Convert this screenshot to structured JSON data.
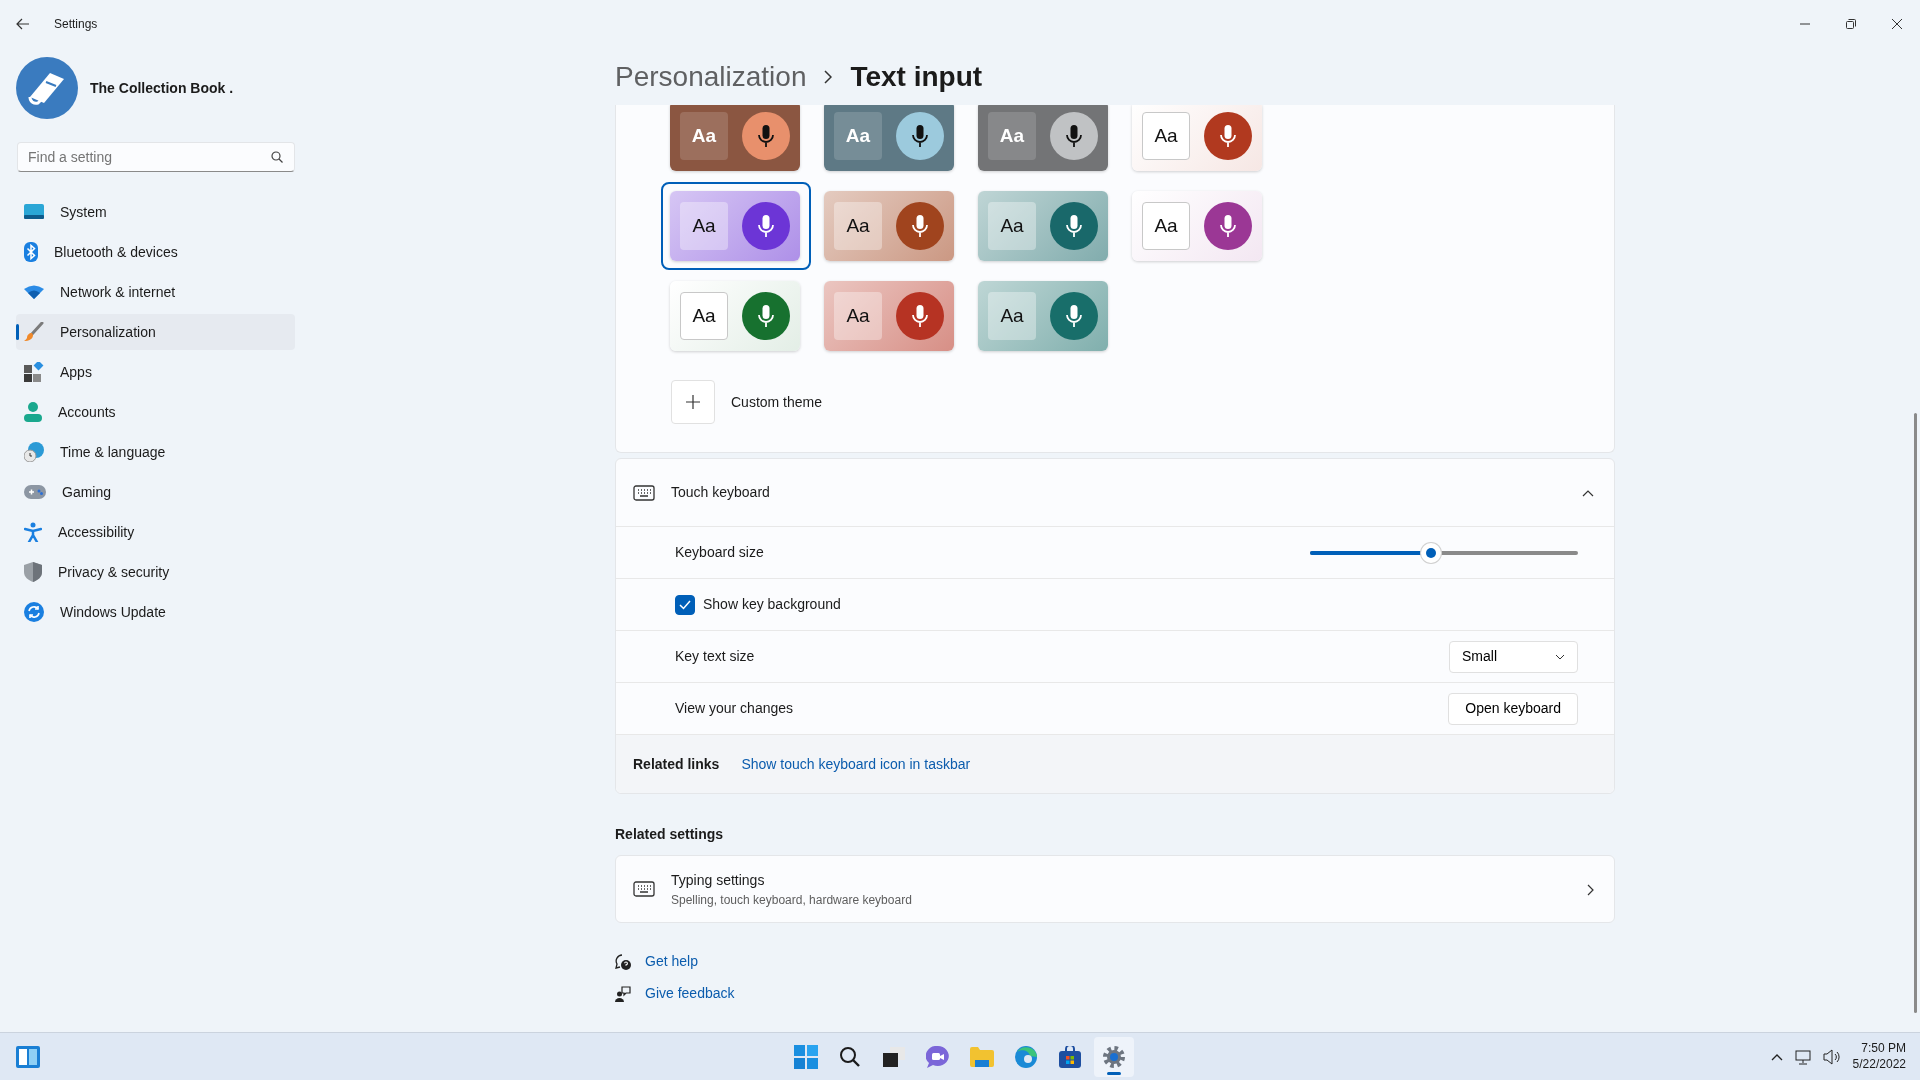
{
  "window": {
    "title": "Settings"
  },
  "profile": {
    "name": "The Collection Book ."
  },
  "search": {
    "placeholder": "Find a setting"
  },
  "nav": [
    {
      "kind": "system",
      "label": "System",
      "selected": false
    },
    {
      "kind": "bluetooth",
      "label": "Bluetooth & devices",
      "selected": false
    },
    {
      "kind": "network",
      "label": "Network & internet",
      "selected": false
    },
    {
      "kind": "personalization",
      "label": "Personalization",
      "selected": true
    },
    {
      "kind": "apps",
      "label": "Apps",
      "selected": false
    },
    {
      "kind": "accounts",
      "label": "Accounts",
      "selected": false
    },
    {
      "kind": "time",
      "label": "Time & language",
      "selected": false
    },
    {
      "kind": "gaming",
      "label": "Gaming",
      "selected": false
    },
    {
      "kind": "accessibility",
      "label": "Accessibility",
      "selected": false
    },
    {
      "kind": "privacy",
      "label": "Privacy & security",
      "selected": false
    },
    {
      "kind": "update",
      "label": "Windows Update",
      "selected": false
    }
  ],
  "breadcrumb": {
    "parent": "Personalization",
    "current": "Text input"
  },
  "themes": [
    {
      "kind": "dark",
      "sample": "Aa",
      "color": "#e8906c",
      "selected": false
    },
    {
      "kind": "dark",
      "sample": "Aa",
      "color": "#9ccadd",
      "selected": false
    },
    {
      "kind": "dark",
      "sample": "Aa",
      "color": "#c0c2c4",
      "selected": false
    },
    {
      "kind": "light",
      "sample": "Aa",
      "color": "#b1391f",
      "selected": false
    },
    {
      "kind": "tinted",
      "sample": "Aa",
      "color": "#6c35d6",
      "selected": true
    },
    {
      "kind": "tinted",
      "sample": "Aa",
      "color": "#a0441e",
      "selected": false
    },
    {
      "kind": "tinted",
      "sample": "Aa",
      "color": "#19686a",
      "selected": false
    },
    {
      "kind": "light",
      "sample": "Aa",
      "color": "#9b3795",
      "selected": false
    },
    {
      "kind": "light",
      "sample": "Aa",
      "color": "#17712f",
      "selected": false
    },
    {
      "kind": "tinted",
      "sample": "Aa",
      "color": "#b63323",
      "selected": false
    },
    {
      "kind": "tinted",
      "sample": "Aa",
      "color": "#186e6a",
      "selected": false
    }
  ],
  "custom_theme": {
    "label": "Custom theme"
  },
  "touch_keyboard": {
    "title": "Touch keyboard",
    "expanded": true,
    "keyboard_size": {
      "label": "Keyboard size",
      "level": 0.45
    },
    "show_key_background": {
      "label": "Show key background",
      "checked": true
    },
    "key_text_size": {
      "label": "Key text size",
      "value": "Small"
    },
    "view_changes": {
      "label": "View your changes",
      "button": "Open keyboard"
    },
    "related_links": {
      "label": "Related links",
      "link": "Show touch keyboard icon in taskbar"
    }
  },
  "related_settings": {
    "heading": "Related settings",
    "items": [
      {
        "title": "Typing settings",
        "subtitle": "Spelling, touch keyboard, hardware keyboard"
      }
    ]
  },
  "help_links": [
    {
      "kind": "help",
      "label": "Get help"
    },
    {
      "kind": "feedback",
      "label": "Give feedback"
    }
  ],
  "taskbar": {
    "apps": [
      {
        "kind": "start",
        "selected": false
      },
      {
        "kind": "search",
        "selected": false
      },
      {
        "kind": "taskview",
        "selected": false
      },
      {
        "kind": "chat",
        "selected": false
      },
      {
        "kind": "explorer",
        "selected": false
      },
      {
        "kind": "edge",
        "selected": false
      },
      {
        "kind": "store",
        "selected": false
      },
      {
        "kind": "settings",
        "selected": true
      }
    ],
    "time": "7:50 PM",
    "date": "5/22/2022"
  }
}
